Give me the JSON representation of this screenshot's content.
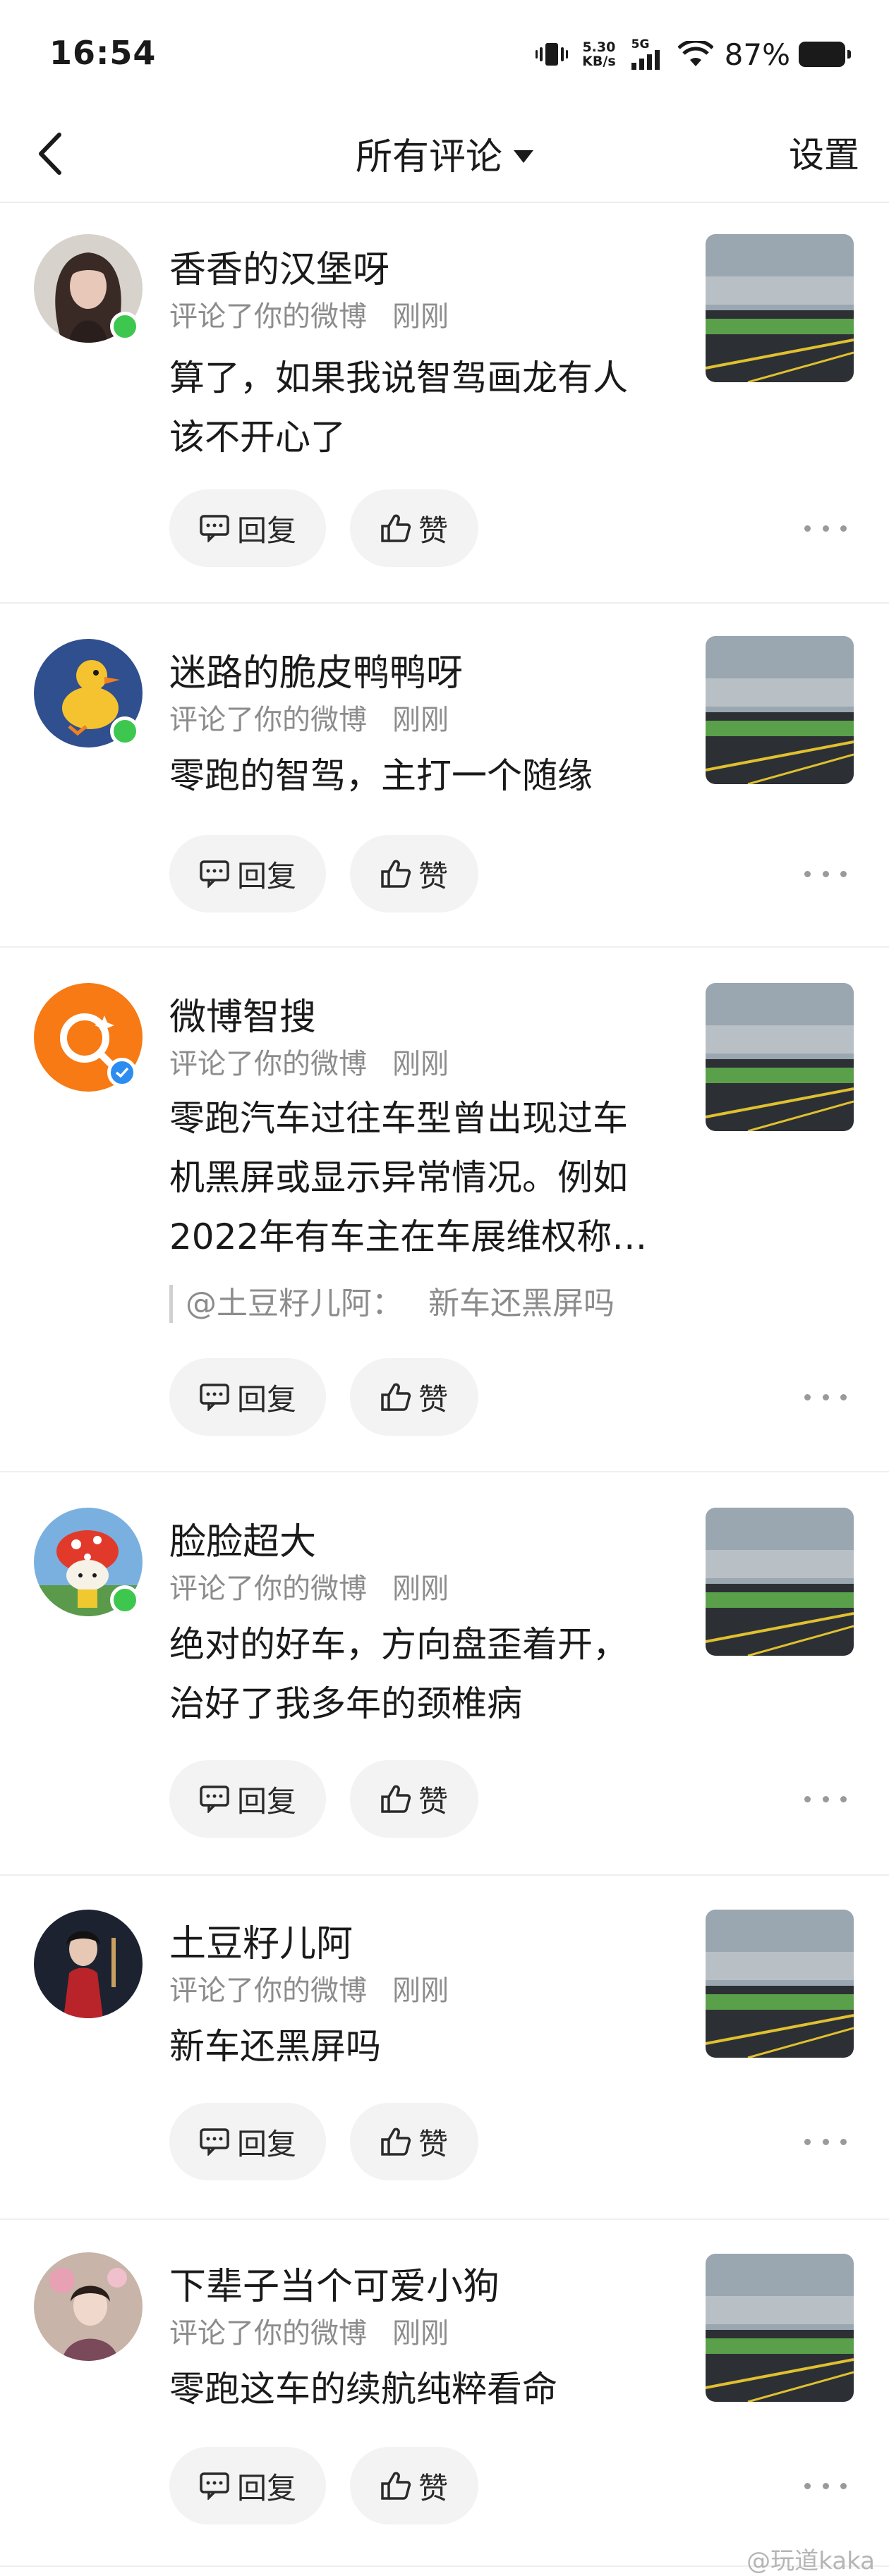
{
  "status_bar": {
    "time": "16:54",
    "net_speed_value": "5.30",
    "net_speed_unit": "KB/s",
    "network_type": "5G",
    "battery": "87%"
  },
  "nav": {
    "back_icon": "chevron-left-icon",
    "title": "所有评论",
    "settings_label": "设置"
  },
  "comments": [
    {
      "name": "香香的汉堡呀",
      "meta_action": "评论了你的微博",
      "meta_time": "刚刚",
      "text_lines": [
        "算了，如果我说智驾画龙有人",
        "该不开心了"
      ],
      "badge": "online"
    },
    {
      "name": "迷路的脆皮鸭鸭呀",
      "meta_action": "评论了你的微博",
      "meta_time": "刚刚",
      "text_lines": [
        "零跑的智驾，主打一个随缘"
      ],
      "badge": "online"
    },
    {
      "name": "微博智搜",
      "meta_action": "评论了你的微博",
      "meta_time": "刚刚",
      "text_lines": [
        "零跑汽车过往车型曾出现过车",
        "机黑屏或显示异常情况。例如",
        "2022年有车主在车展维权称…"
      ],
      "quote_user": "@土豆籽儿阿：",
      "quote_text": "新车还黑屏吗",
      "badge": "verified"
    },
    {
      "name": "脸脸超大",
      "meta_action": "评论了你的微博",
      "meta_time": "刚刚",
      "text_lines": [
        "绝对的好车，方向盘歪着开，",
        "治好了我多年的颈椎病"
      ],
      "badge": "online"
    },
    {
      "name": "土豆籽儿阿",
      "meta_action": "评论了你的微博",
      "meta_time": "刚刚",
      "text_lines": [
        "新车还黑屏吗"
      ],
      "badge": "none"
    },
    {
      "name": "下辈子当个可爱小狗",
      "meta_action": "评论了你的微博",
      "meta_time": "刚刚",
      "text_lines": [
        "零跑这车的续航纯粹看命"
      ],
      "badge": "none"
    }
  ],
  "buttons": {
    "reply_label": "回复",
    "like_label": "赞"
  },
  "watermark": "@玩道kaka",
  "colors": {
    "online_badge": "#3ec74e",
    "verified_badge": "#2d8cf0",
    "weibo_smart_search": "#f77a14"
  }
}
